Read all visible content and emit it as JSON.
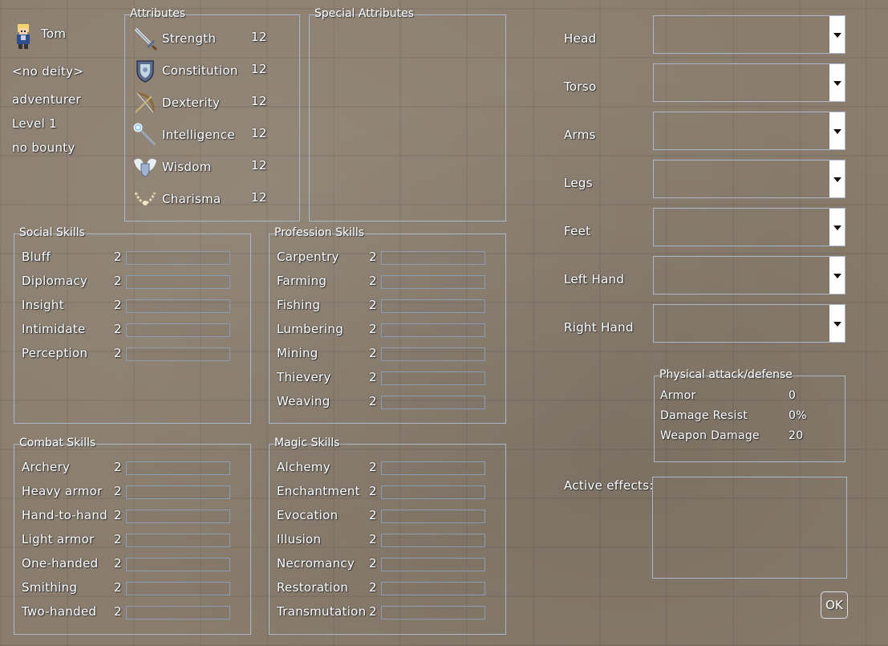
{
  "character": {
    "name": "Tom",
    "deity": "<no deity>",
    "class": "adventurer",
    "level": "Level 1",
    "bounty": "no bounty"
  },
  "attributes": {
    "title": "Attributes",
    "items": [
      {
        "name": "Strength",
        "value": "12",
        "icon": "sword-icon"
      },
      {
        "name": "Constitution",
        "value": "12",
        "icon": "shield-icon"
      },
      {
        "name": "Dexterity",
        "value": "12",
        "icon": "bow-icon"
      },
      {
        "name": "Intelligence",
        "value": "12",
        "icon": "wand-icon"
      },
      {
        "name": "Wisdom",
        "value": "12",
        "icon": "winged-shield-icon"
      },
      {
        "name": "Charisma",
        "value": "12",
        "icon": "necklace-icon"
      }
    ]
  },
  "special_attributes": {
    "title": "Special Attributes"
  },
  "social_skills": {
    "title": "Social Skills",
    "items": [
      {
        "name": "Bluff",
        "value": "2",
        "progress": 0
      },
      {
        "name": "Diplomacy",
        "value": "2",
        "progress": 0
      },
      {
        "name": "Insight",
        "value": "2",
        "progress": 0
      },
      {
        "name": "Intimidate",
        "value": "2",
        "progress": 0
      },
      {
        "name": "Perception",
        "value": "2",
        "progress": 0
      }
    ]
  },
  "profession_skills": {
    "title": "Profession Skills",
    "items": [
      {
        "name": "Carpentry",
        "value": "2",
        "progress": 0
      },
      {
        "name": "Farming",
        "value": "2",
        "progress": 0
      },
      {
        "name": "Fishing",
        "value": "2",
        "progress": 0
      },
      {
        "name": "Lumbering",
        "value": "2",
        "progress": 0
      },
      {
        "name": "Mining",
        "value": "2",
        "progress": 0
      },
      {
        "name": "Thievery",
        "value": "2",
        "progress": 0
      },
      {
        "name": "Weaving",
        "value": "2",
        "progress": 0
      }
    ]
  },
  "combat_skills": {
    "title": "Combat Skills",
    "items": [
      {
        "name": "Archery",
        "value": "2",
        "progress": 0
      },
      {
        "name": "Heavy armor",
        "value": "2",
        "progress": 0
      },
      {
        "name": "Hand-to-hand",
        "value": "2",
        "progress": 0
      },
      {
        "name": "Light armor",
        "value": "2",
        "progress": 0
      },
      {
        "name": "One-handed",
        "value": "2",
        "progress": 0
      },
      {
        "name": "Smithing",
        "value": "2",
        "progress": 0
      },
      {
        "name": "Two-handed",
        "value": "2",
        "progress": 0
      }
    ]
  },
  "magic_skills": {
    "title": "Magic Skills",
    "items": [
      {
        "name": "Alchemy",
        "value": "2",
        "progress": 0
      },
      {
        "name": "Enchantment",
        "value": "2",
        "progress": 0
      },
      {
        "name": "Evocation",
        "value": "2",
        "progress": 0
      },
      {
        "name": "Illusion",
        "value": "2",
        "progress": 0
      },
      {
        "name": "Necromancy",
        "value": "2",
        "progress": 0
      },
      {
        "name": "Restoration",
        "value": "2",
        "progress": 0
      },
      {
        "name": "Transmutation",
        "value": "2",
        "progress": 0
      }
    ]
  },
  "equipment": {
    "slots": [
      {
        "label": "Head",
        "value": ""
      },
      {
        "label": "Torso",
        "value": ""
      },
      {
        "label": "Arms",
        "value": ""
      },
      {
        "label": "Legs",
        "value": ""
      },
      {
        "label": "Feet",
        "value": ""
      },
      {
        "label": "Left Hand",
        "value": ""
      },
      {
        "label": "Right Hand",
        "value": ""
      }
    ]
  },
  "physical": {
    "title": "Physical attack/defense",
    "rows": [
      {
        "label": "Armor",
        "value": "0"
      },
      {
        "label": "Damage Resist",
        "value": "0%"
      },
      {
        "label": "Weapon Damage",
        "value": "20"
      }
    ]
  },
  "active_effects": {
    "label": "Active effects:"
  },
  "ok_label": "OK",
  "colors": {
    "frame_border": "#a9b7c9",
    "text": "#ffffff",
    "background": "#8a7d6e"
  }
}
